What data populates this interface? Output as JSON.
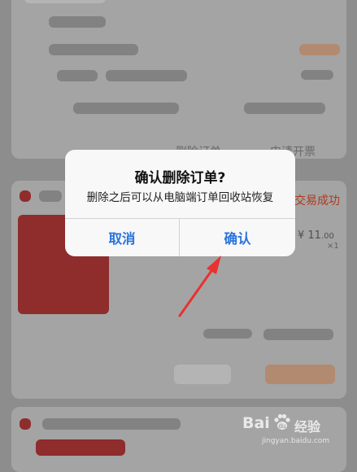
{
  "background": {
    "order_actions": [
      "删除订单",
      "申请开票"
    ],
    "order_status": "交易成功",
    "price": {
      "integer": "¥ 11",
      "decimal": ".00"
    },
    "quantity": "×1"
  },
  "dialog": {
    "title": "确认删除订单?",
    "message": "删除之后可以从电脑端订单回收站恢复",
    "cancel_label": "取消",
    "confirm_label": "确认"
  },
  "annotation": {
    "arrow_color": "#e8322f"
  },
  "watermark": {
    "brand": "Bai",
    "brand_tail": "经验",
    "paw": "du",
    "url": "jingyan.baidu.com"
  },
  "colors": {
    "accent": "#2a74dd",
    "status": "#b0391c"
  }
}
